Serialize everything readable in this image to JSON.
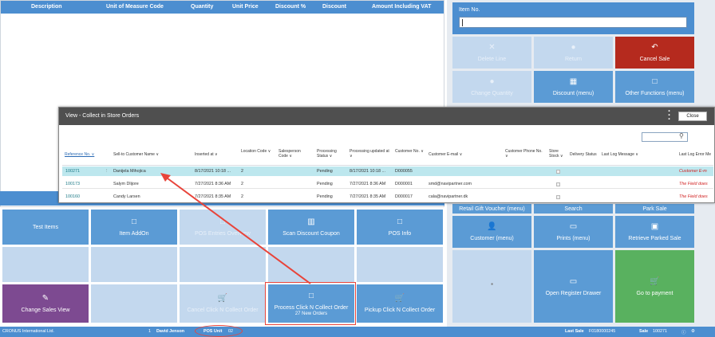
{
  "sales_grid": {
    "columns": [
      "Description",
      "Unit of Measure Code",
      "Quantity",
      "Unit Price",
      "Discount %",
      "Discount",
      "Amount Including VAT"
    ]
  },
  "item_no": {
    "label": "Item No.",
    "value": ""
  },
  "right_tiles": {
    "delete_line": "Delete Line",
    "return": "Return",
    "cancel_sale": "Cancel Sale",
    "change_quantity": "Change Quantity",
    "discount_menu": "Discount (menu)",
    "other_functions": "Other Functions (menu)",
    "retail_gift_voucher": "Retail Gift Voucher (menu)",
    "search": "Search",
    "park_sale": "Park Sale",
    "customer_menu": "Customer (menu)",
    "prints_menu": "Prints (menu)",
    "retrieve_parked_sale": "Retrieve Parked Sale",
    "open_register_drawer": "Open Register Drawer",
    "go_to_payment": "Go to payment"
  },
  "left_tiles": {
    "test_items": "Test Items",
    "item_addon": "Item AddOn",
    "pos_entries": "POS Entries Overview",
    "scan_discount_coupon": "Scan Discount Coupon",
    "pos_info": "POS Info",
    "change_sales_view": "Change Sales View",
    "cancel_click_n_collect": "Cancel Click N Collect Order",
    "process_click_n_collect": "Process Click N Collect Order",
    "process_sub": "27 New Orders",
    "pickup_click_n_collect": "Pickup Click N Collect Order"
  },
  "modal": {
    "title": "View - Collect in Store Orders",
    "close_label": "Close",
    "headers": {
      "reference_no": "Reference No. ∨",
      "sell_to_customer": "Sell-to Customer Name ∨",
      "inserted_at": "Inserted at ∨",
      "location_code": "Location Code ∨",
      "salesperson_code": "Salesperson Code ∨",
      "processing_status": "Processing Status ∨",
      "processing_updated": "Processing updated at ∨",
      "customer_no": "Customer No. ∨",
      "customer_email": "Customer E-mail ∨",
      "customer_phone": "Customer Phone No. ∨",
      "store_stock": "Store Stock ∨",
      "delivery_status": "Delivery Status",
      "last_log_message": "Last Log Message ∨",
      "last_log_error": "Last Log Error Me"
    },
    "rows": [
      {
        "ref": "100271",
        "name": "Danijela Mihojica",
        "inserted": "8/17/2021 10:18 ...",
        "location": "2",
        "status": "Pending",
        "updated": "8/17/2021 10:18 ...",
        "customer_no": "D000055",
        "email": "",
        "error": "Customer E-m"
      },
      {
        "ref": "100173",
        "name": "Salym Dlijore",
        "inserted": "7/27/2021 8:36 AM",
        "location": "2",
        "status": "Pending",
        "updated": "7/27/2021 8:36 AM",
        "customer_no": "D000001",
        "email": "smd@navipartner.com",
        "error": "The Field does"
      },
      {
        "ref": "100160",
        "name": "Candy Larsen",
        "inserted": "7/27/2021 8:35 AM",
        "location": "2",
        "status": "Pending",
        "updated": "7/27/2021 8:35 AM",
        "customer_no": "D000017",
        "email": "cala@navipartner.dk",
        "error": "The Field does"
      }
    ]
  },
  "status_bar": {
    "company": "CRONUS International Ltd.",
    "salesperson_no": "1",
    "salesperson": "David Jenson",
    "pos_unit_label": "POS Unit",
    "pos_unit_value": "02",
    "last_sale_label": "Last Sale",
    "last_sale_value": "F0180000245",
    "sale_label": "Sale",
    "sale_value": "100271"
  },
  "colors": {
    "primary": "#4c8ed0",
    "tile": "#5b9bd5",
    "cancel": "#b52a1e",
    "payment": "#59b15f",
    "sales_view": "#7d4a91",
    "annotation": "#e8443a"
  }
}
